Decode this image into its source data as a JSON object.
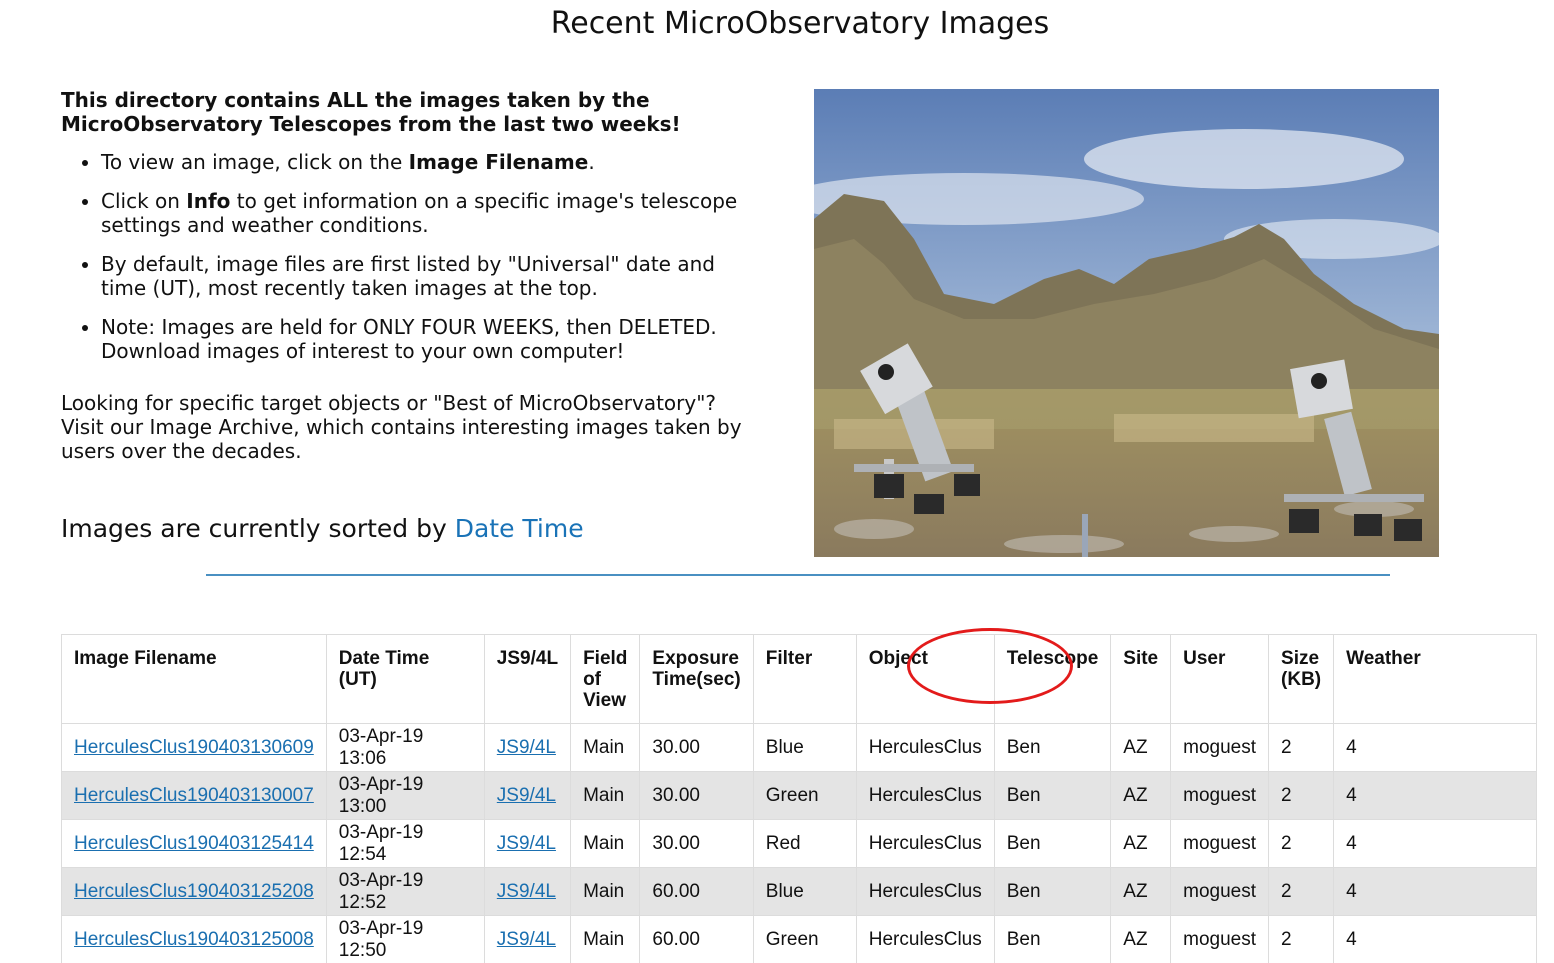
{
  "page": {
    "title": "Recent MicroObservatory Images"
  },
  "intro": {
    "lead": "This directory contains ALL the images taken by the MicroObservatory Telescopes from the last two weeks!",
    "b1_pre": "To view an image, click on the ",
    "b1_bold": "Image Filename",
    "b1_post": ".",
    "b2_pre": "Click on ",
    "b2_bold": "Info",
    "b2_post": " to get information on a specific image's telescope settings and weather conditions.",
    "b3": "By default, image files are first listed by \"Universal\" date and time (UT), most recently taken images at the top.",
    "b4": "Note: Images are held for ONLY FOUR WEEKS, then DELETED. Download images of interest to your own computer!",
    "archive": "Looking for specific target objects or \"Best of MicroObservatory\"? Visit our Image Archive, which contains interesting images taken by users over the decades."
  },
  "sort": {
    "prefix": "Images are currently sorted by ",
    "link": "Date Time",
    "link_color": "#1a73b7"
  },
  "table": {
    "headers": [
      "Image Filename",
      "Date Time (UT)",
      "JS9/4L",
      "Field of View",
      "Exposure Time(sec)",
      "Filter",
      "Object",
      "Telescope",
      "Site",
      "User",
      "Size (KB)",
      "Weather"
    ],
    "rows": [
      {
        "filename": "HerculesClus190403130609",
        "datetime": "03-Apr-19 13:06",
        "js9": "JS9/4L",
        "fov": "Main",
        "exposure": "30.00",
        "filter": "Blue",
        "object": "HerculesClus",
        "telescope": "Ben",
        "site": "AZ",
        "user": "moguest",
        "size": "2",
        "weather": "4"
      },
      {
        "filename": "HerculesClus190403130007",
        "datetime": "03-Apr-19 13:00",
        "js9": "JS9/4L",
        "fov": "Main",
        "exposure": "30.00",
        "filter": "Green",
        "object": "HerculesClus",
        "telescope": "Ben",
        "site": "AZ",
        "user": "moguest",
        "size": "2",
        "weather": "4"
      },
      {
        "filename": "HerculesClus190403125414",
        "datetime": "03-Apr-19 12:54",
        "js9": "JS9/4L",
        "fov": "Main",
        "exposure": "30.00",
        "filter": "Red",
        "object": "HerculesClus",
        "telescope": "Ben",
        "site": "AZ",
        "user": "moguest",
        "size": "2",
        "weather": "4"
      },
      {
        "filename": "HerculesClus190403125208",
        "datetime": "03-Apr-19 12:52",
        "js9": "JS9/4L",
        "fov": "Main",
        "exposure": "60.00",
        "filter": "Blue",
        "object": "HerculesClus",
        "telescope": "Ben",
        "site": "AZ",
        "user": "moguest",
        "size": "2",
        "weather": "4"
      },
      {
        "filename": "HerculesClus190403125008",
        "datetime": "03-Apr-19 12:50",
        "js9": "JS9/4L",
        "fov": "Main",
        "exposure": "60.00",
        "filter": "Green",
        "object": "HerculesClus",
        "telescope": "Ben",
        "site": "AZ",
        "user": "moguest",
        "size": "2",
        "weather": "4"
      }
    ],
    "row_alt_color": "#e4e4e4",
    "link_color": "#1a6fb0"
  },
  "annotation": {
    "circle_color": "#e31b1b"
  }
}
